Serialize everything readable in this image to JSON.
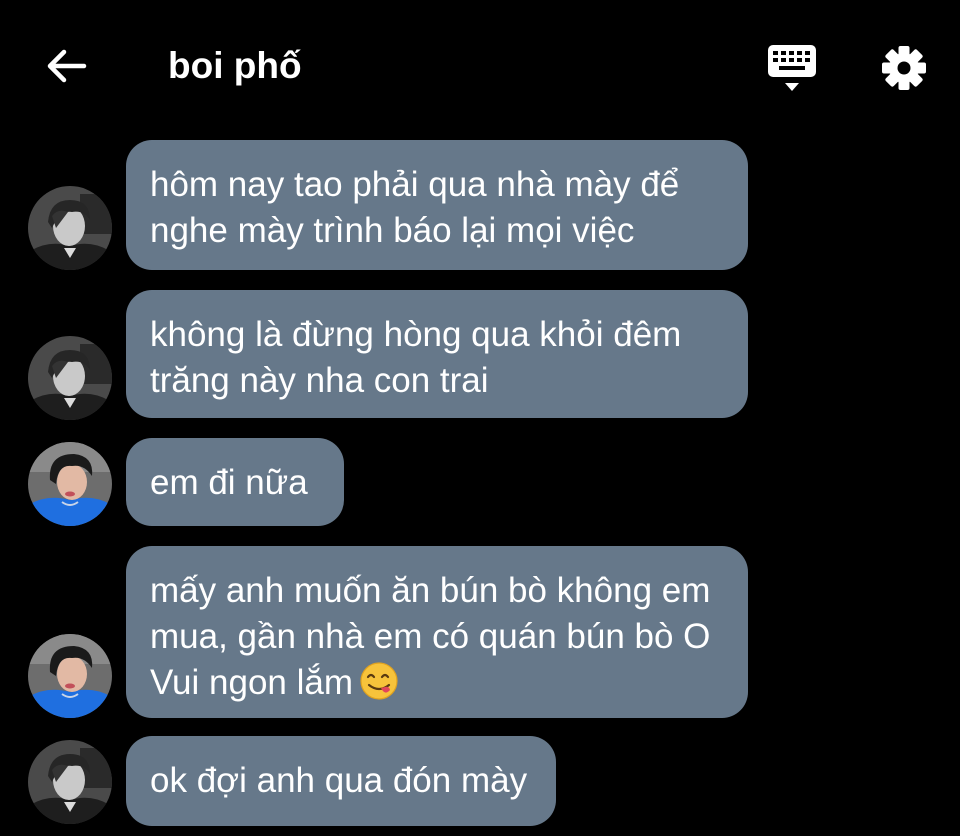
{
  "header": {
    "back_icon": "arrow-left-icon",
    "title": "boi phố",
    "keyboard_icon": "keyboard-icon",
    "settings_icon": "gear-icon"
  },
  "colors": {
    "background": "#000000",
    "bubble": "#66788a",
    "text": "#ffffff"
  },
  "messages": [
    {
      "avatar": "avatar-gray-hair",
      "lines": [
        "hôm nay tao phải qua nhà mày để",
        "nghe mày trình báo lại mọi việc"
      ]
    },
    {
      "avatar": "avatar-gray-hair",
      "lines": [
        "không là đừng hòng qua khỏi đêm",
        "trăng này nha con trai"
      ]
    },
    {
      "avatar": "avatar-blue-shirt",
      "lines": [
        "em đi nữa"
      ]
    },
    {
      "avatar": "avatar-blue-shirt",
      "lines": [
        "mấy anh muốn ăn bún bò không em",
        "mua, gần nhà em có quán bún bò O",
        "Vui ngon lắm"
      ],
      "emoji": "face-savoring-food-emoji"
    },
    {
      "avatar": "avatar-gray-hair",
      "lines": [
        "ok đợi anh qua đón mày"
      ]
    }
  ]
}
